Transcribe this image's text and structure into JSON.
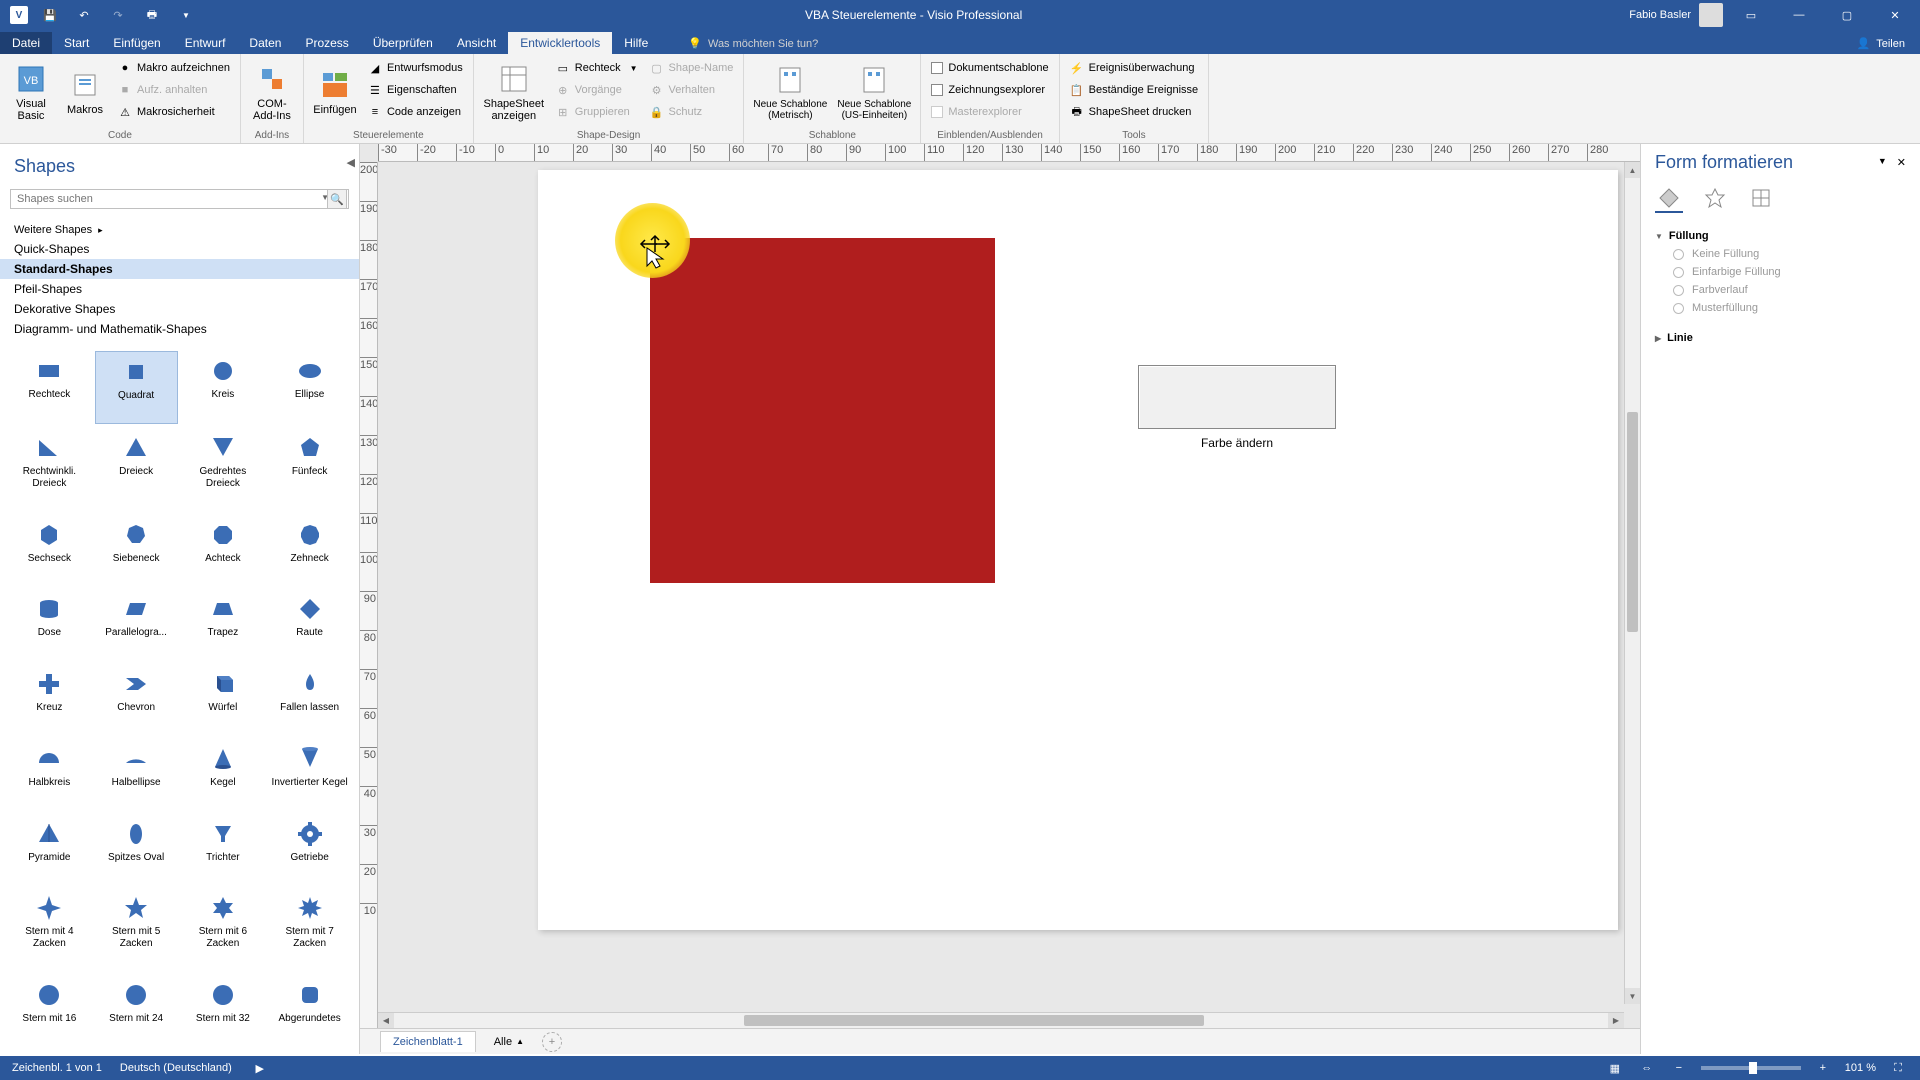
{
  "titlebar": {
    "app_title": "VBA Steuerelemente - Visio Professional",
    "user_name": "Fabio Basler"
  },
  "menu": {
    "tabs": [
      "Datei",
      "Start",
      "Einfügen",
      "Entwurf",
      "Daten",
      "Prozess",
      "Überprüfen",
      "Ansicht",
      "Entwicklertools",
      "Hilfe"
    ],
    "active_index": 8,
    "tell_me": "Was möchten Sie tun?",
    "share": "Teilen"
  },
  "ribbon": {
    "groups": {
      "code": {
        "label": "Code",
        "visual_basic": "Visual\nBasic",
        "makros": "Makros",
        "makro_aufzeichnen": "Makro aufzeichnen",
        "aufz_anhalten": "Aufz. anhalten",
        "makrosicherheit": "Makrosicherheit"
      },
      "addins": {
        "label": "Add-Ins",
        "com_addins": "COM-\nAdd-Ins"
      },
      "steuer": {
        "label": "Steuerelemente",
        "einfugen": "Einfügen",
        "entwurfsmodus": "Entwurfsmodus",
        "eigenschaften": "Eigenschaften",
        "code_anzeigen": "Code anzeigen"
      },
      "shape_design": {
        "label": "Shape-Design",
        "shapesheet": "ShapeSheet\nanzeigen",
        "rechteck": "Rechteck",
        "vorgange": "Vorgänge",
        "gruppieren": "Gruppieren",
        "shape_name": "Shape-Name",
        "verhalten": "Verhalten",
        "schutz": "Schutz"
      },
      "schablone": {
        "label": "Schablone",
        "neue_metrisch": "Neue Schablone\n(Metrisch)",
        "neue_us": "Neue Schablone\n(US-Einheiten)"
      },
      "einblenden": {
        "label": "Einblenden/Ausblenden",
        "dokumentschablone": "Dokumentschablone",
        "zeichnungsexplorer": "Zeichnungsexplorer",
        "masterexplorer": "Masterexplorer"
      },
      "tools": {
        "label": "Tools",
        "ereignis": "Ereignisüberwachung",
        "bestandige": "Beständige Ereignisse",
        "shapesheet_drucken": "ShapeSheet drucken"
      }
    }
  },
  "shapes_panel": {
    "title": "Shapes",
    "search_placeholder": "Shapes suchen",
    "categories": [
      "Weitere Shapes",
      "Quick-Shapes",
      "Standard-Shapes",
      "Pfeil-Shapes",
      "Dekorative Shapes",
      "Diagramm- und Mathematik-Shapes"
    ],
    "selected_category_index": 2,
    "shapes": [
      "Rechteck",
      "Quadrat",
      "Kreis",
      "Ellipse",
      "Rechtwinkli. Dreieck",
      "Dreieck",
      "Gedrehtes Dreieck",
      "Fünfeck",
      "Sechseck",
      "Siebeneck",
      "Achteck",
      "Zehneck",
      "Dose",
      "Parallelogra...",
      "Trapez",
      "Raute",
      "Kreuz",
      "Chevron",
      "Würfel",
      "Fallen lassen",
      "Halbkreis",
      "Halbellipse",
      "Kegel",
      "Invertierter Kegel",
      "Pyramide",
      "Spitzes Oval",
      "Trichter",
      "Getriebe",
      "Stern mit 4 Zacken",
      "Stern mit 5 Zacken",
      "Stern mit 6 Zacken",
      "Stern mit 7 Zacken",
      "Stern mit 16",
      "Stern mit 24",
      "Stern mit 32",
      "Abgerundetes"
    ],
    "selected_shape_index": 1
  },
  "canvas": {
    "control_label": "Farbe ändern",
    "ruler_h": [
      -30,
      -20,
      -10,
      0,
      10,
      20,
      30,
      40,
      50,
      60,
      70,
      80,
      90,
      100,
      110,
      120,
      130,
      140,
      150,
      160,
      170,
      180,
      190,
      200,
      210,
      220,
      230,
      240,
      250,
      260,
      270,
      280
    ],
    "ruler_v": [
      200,
      190,
      180,
      170,
      160,
      150,
      140,
      130,
      120,
      110,
      100,
      90,
      80,
      70,
      60,
      50,
      40,
      30,
      20,
      10
    ]
  },
  "page_tabs": {
    "active": "Zeichenblatt-1",
    "all": "Alle"
  },
  "format_panel": {
    "title": "Form formatieren",
    "section_fill": "Füllung",
    "section_line": "Linie",
    "options": [
      "Keine Füllung",
      "Einfarbige Füllung",
      "Farbverlauf",
      "Musterfüllung"
    ]
  },
  "statusbar": {
    "page_info": "Zeichenbl. 1 von 1",
    "language": "Deutsch (Deutschland)",
    "zoom": "101 %"
  }
}
